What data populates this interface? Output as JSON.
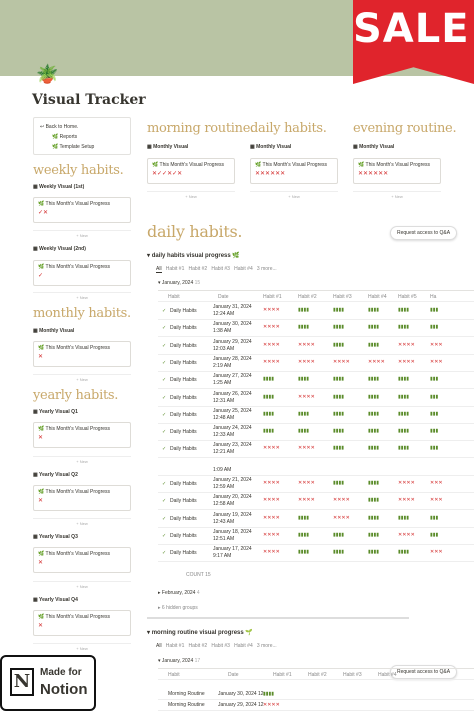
{
  "title": "Visual Tracker",
  "sale": "SALE!",
  "sidebar": {
    "back": "Back to Home.",
    "reports": "Reports",
    "setup": "Template Setup",
    "weekly": "weekly habits.",
    "weekly_v1": "Weekly Visual (1st)",
    "weekly_v2": "Weekly Visual (2nd)",
    "monthly": "monthly habits.",
    "monthly_v": "Monthly Visual",
    "yearly": "yearly habits.",
    "yq1": "Yearly Visual Q1",
    "yq2": "Yearly Visual Q2",
    "yq3": "Yearly Visual Q3",
    "yq4": "Yearly Visual Q4",
    "card": "This Month's Visual Progress",
    "new": "+ New"
  },
  "cols": {
    "morning": "morning routine.",
    "daily": "daily habits.",
    "evening": "evening routine.",
    "mv": "Monthly Visual",
    "card": "This Month's Visual Progress",
    "new": "+ New",
    "marks1": "✕✓✓✕✓✕",
    "marks2": "✕✕✕✕✕✕",
    "marks3": "✕✕✕✕✕✕"
  },
  "main": {
    "heading": "daily habits.",
    "request": "Request access to Q&A",
    "view": "daily habits visual progress",
    "tabs": [
      "All",
      "Habit #1",
      "Habit #2",
      "Habit #3",
      "Habit #4",
      "3 more..."
    ],
    "group1": "January, 2024",
    "g1count": "15",
    "headers": [
      "Habit",
      "Date",
      "Habit #1",
      "Habit #2",
      "Habit #3",
      "Habit #4",
      "Habit #5",
      "Ha"
    ],
    "rows": [
      {
        "h": "Daily Habits",
        "d": "January 31, 2024",
        "t": "12:24 AM",
        "c": [
          "✕✕✕✕",
          "▮▮▮▮",
          "▮▮▮▮",
          "▮▮▮▮",
          "▮▮▮▮",
          "▮▮▮"
        ]
      },
      {
        "h": "Daily Habits",
        "d": "January 30, 2024",
        "t": "1:38 AM",
        "c": [
          "✕✕✕✕",
          "▮▮▮▮",
          "▮▮▮▮",
          "▮▮▮▮",
          "▮▮▮▮",
          "▮▮▮"
        ]
      },
      {
        "h": "Daily Habits",
        "d": "January 29, 2024",
        "t": "12:03 AM",
        "c": [
          "✕✕✕✕",
          "✕✕✕✕",
          "▮▮▮▮",
          "▮▮▮▮",
          "✕✕✕✕",
          "✕✕✕"
        ]
      },
      {
        "h": "Daily Habits",
        "d": "January 28, 2024",
        "t": "2:19 AM",
        "c": [
          "✕✕✕✕",
          "✕✕✕✕",
          "✕✕✕✕",
          "✕✕✕✕",
          "✕✕✕✕",
          "✕✕✕"
        ]
      },
      {
        "h": "Daily Habits",
        "d": "January 27, 2024",
        "t": "1:25 AM",
        "c": [
          "▮▮▮▮",
          "▮▮▮▮",
          "▮▮▮▮",
          "▮▮▮▮",
          "▮▮▮▮",
          "▮▮▮"
        ]
      },
      {
        "h": "Daily Habits",
        "d": "January 26, 2024",
        "t": "12:31 AM",
        "c": [
          "▮▮▮▮",
          "✕✕✕✕",
          "▮▮▮▮",
          "▮▮▮▮",
          "▮▮▮▮",
          "▮▮▮"
        ]
      },
      {
        "h": "Daily Habits",
        "d": "January 25, 2024",
        "t": "12:48 AM",
        "c": [
          "▮▮▮▮",
          "▮▮▮▮",
          "▮▮▮▮",
          "▮▮▮▮",
          "▮▮▮▮",
          "▮▮▮"
        ]
      },
      {
        "h": "Daily Habits",
        "d": "January 24, 2024",
        "t": "12:33 AM",
        "c": [
          "▮▮▮▮",
          "▮▮▮▮",
          "▮▮▮▮",
          "▮▮▮▮",
          "▮▮▮▮",
          "▮▮▮"
        ]
      },
      {
        "h": "Daily Habits",
        "d": "January 23, 2024",
        "t": "12:21 AM",
        "c": [
          "✕✕✕✕",
          "✕✕✕✕",
          "▮▮▮▮",
          "▮▮▮▮",
          "▮▮▮▮",
          "▮▮▮"
        ]
      },
      {
        "h": "",
        "d": "",
        "t": "1:09 AM",
        "c": [
          "",
          "",
          "",
          "",
          "",
          ""
        ]
      },
      {
        "h": "Daily Habits",
        "d": "January 21, 2024",
        "t": "12:59 AM",
        "c": [
          "✕✕✕✕",
          "✕✕✕✕",
          "▮▮▮▮",
          "▮▮▮▮",
          "✕✕✕✕",
          "✕✕✕"
        ]
      },
      {
        "h": "Daily Habits",
        "d": "January 20, 2024",
        "t": "12:58 AM",
        "c": [
          "✕✕✕✕",
          "✕✕✕✕",
          "✕✕✕✕",
          "▮▮▮▮",
          "✕✕✕✕",
          "✕✕✕"
        ]
      },
      {
        "h": "Daily Habits",
        "d": "January 19, 2024",
        "t": "12:43 AM",
        "c": [
          "✕✕✕✕",
          "▮▮▮▮",
          "✕✕✕✕",
          "▮▮▮▮",
          "▮▮▮▮",
          "▮▮▮"
        ]
      },
      {
        "h": "Daily Habits",
        "d": "January 18, 2024",
        "t": "12:51 AM",
        "c": [
          "✕✕✕✕",
          "▮▮▮▮",
          "▮▮▮▮",
          "▮▮▮▮",
          "✕✕✕✕",
          "▮▮▮"
        ]
      },
      {
        "h": "Daily Habits",
        "d": "January 17, 2024",
        "t": "9:17 AM",
        "c": [
          "✕✕✕✕",
          "▮▮▮▮",
          "▮▮▮▮",
          "▮▮▮▮",
          "▮▮▮▮",
          "✕✕✕"
        ]
      }
    ],
    "count": "COUNT 15",
    "group2": "February, 2024",
    "g2count": "4",
    "hidden": "6 hidden groups",
    "view2": "morning routine visual progress",
    "tabs2": [
      "All",
      "Habit #1",
      "Habit #2",
      "Habit #3",
      "Habit #4",
      "3 more..."
    ],
    "group3": "January, 2024",
    "g3count": "17",
    "headers2": [
      "Habit",
      "Date",
      "Habit #1",
      "Habit #2",
      "Habit #3",
      "Habit #4"
    ],
    "rows2": [
      {
        "h": "Morning Routine",
        "d": "January 30, 2024 12",
        "c": "▮▮▮▮"
      },
      {
        "h": "Morning Routine",
        "d": "January 29, 2024 12",
        "c": "✕✕✕✕"
      }
    ]
  },
  "notion": {
    "l1": "Made for",
    "l2": "Notion"
  }
}
